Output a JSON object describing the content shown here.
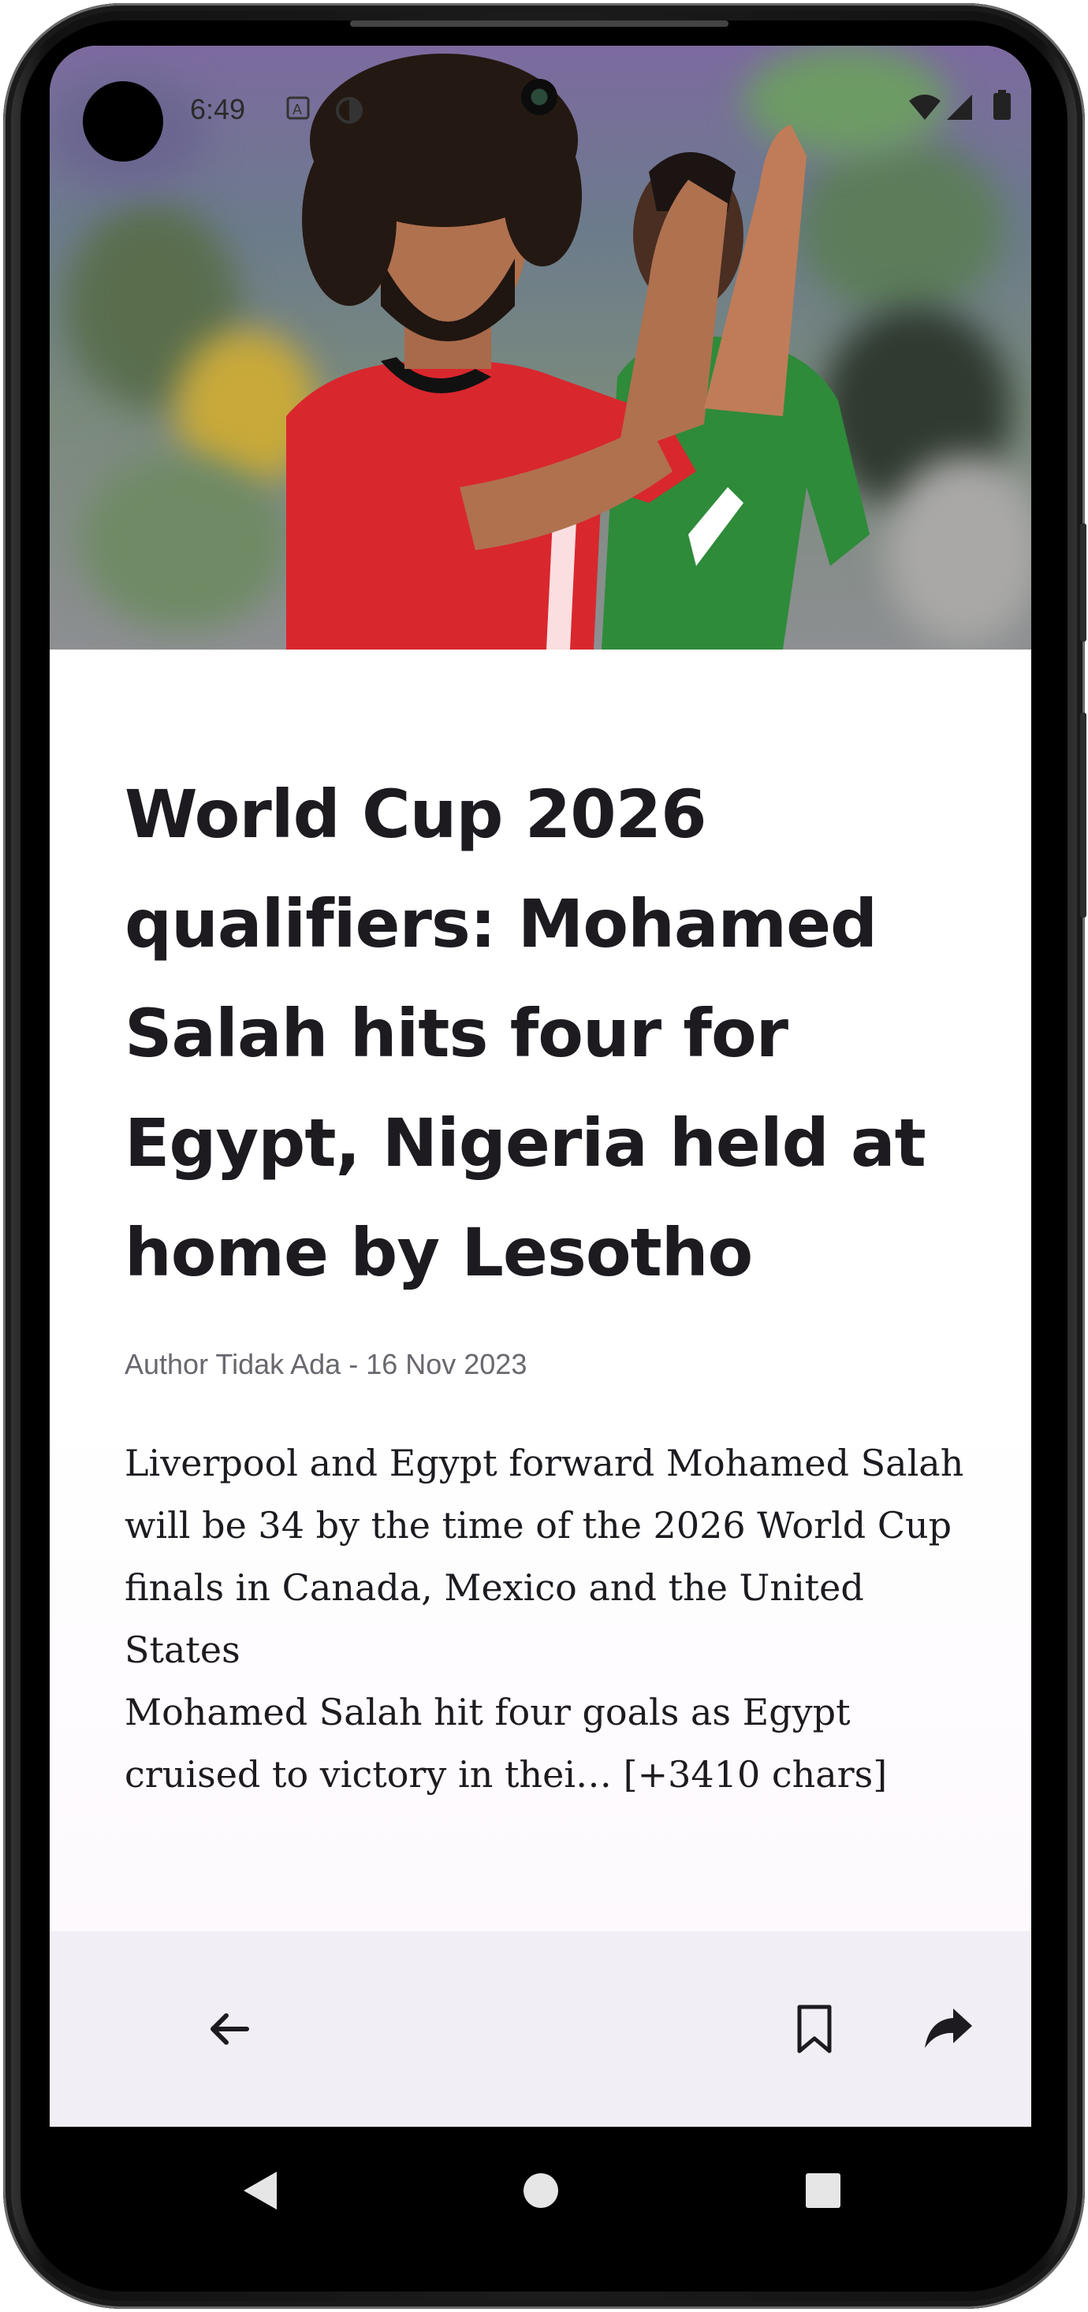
{
  "status_bar": {
    "time": "6:49",
    "icons": [
      "a-icon",
      "contrast-icon",
      "wifi-icon",
      "signal-icon",
      "battery-icon"
    ]
  },
  "hero_image": {
    "alt": "",
    "icon": "photo"
  },
  "article": {
    "title": "World Cup 2026 qualifiers: Mohamed Salah hits four for Egypt, Nigeria held at home by Lesotho",
    "author": "Author Tidak Ada",
    "separator": "-",
    "date": "16 Nov 2023",
    "body": "Liverpool and Egypt forward Mohamed Salah will be 34 by the time of the 2026 World Cup finals in Canada, Mexico and the United States\nMohamed Salah hit four goals as Egypt cruised to victory in thei… [+3410 chars]"
  },
  "bottom_bar": {
    "back_icon": "arrow-left-icon",
    "bookmark_icon": "bookmark-icon",
    "share_icon": "share-icon"
  },
  "nav_bar": {
    "back_icon": "nav-back-icon",
    "home_icon": "nav-home-icon",
    "recents_icon": "nav-recents-icon"
  },
  "colors": {
    "title": "#1d1b20",
    "meta": "#6b676f",
    "bottom_bar_bg": "#f1eef5",
    "jersey_red": "#d9272e",
    "jersey_green": "#2e8b3a"
  }
}
